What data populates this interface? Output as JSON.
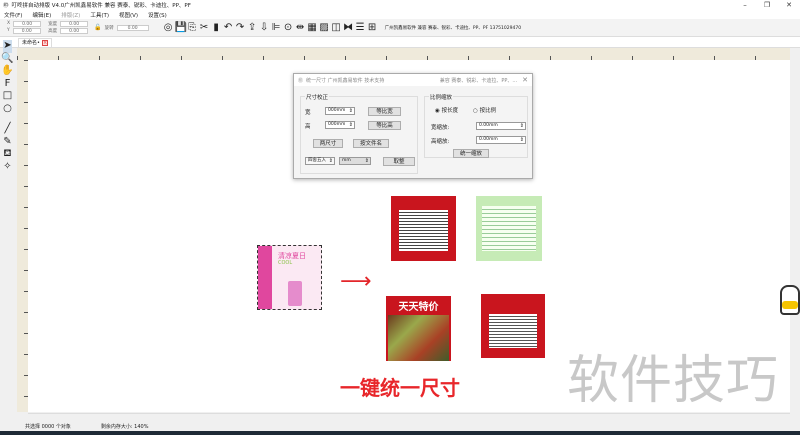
{
  "window": {
    "title": "叮咚拼自动排版 V4.0广州凯鑫易软件 兼容 赛泰、锐彩、卡迪拉、PP、PF"
  },
  "menu": [
    "文件(F)",
    "编辑(E)",
    "排版(Z)",
    "工具(T)",
    "视图(V)",
    "设置(S)"
  ],
  "toolbar": {
    "x_label": "X",
    "y_label": "Y",
    "x": "0.00",
    "y": "0.00",
    "width_label": "宽度",
    "height_label": "高度",
    "width": "0.00",
    "height": "0.00",
    "rotate_label": "旋转",
    "rotate": "0.00",
    "info": "广州凯鑫易软件 兼容 赛泰、锐彩、卡迪拉、PP、PF  13751029470"
  },
  "tab": {
    "label": "未命名•"
  },
  "dialog": {
    "title": "统一尺寸 广州凯鑫易软件 技术支持",
    "title_right": "兼容 赛泰、锐彩、卡迪拉、PP、...",
    "size_group": "尺寸校正",
    "width_label": "宽",
    "height_label": "高",
    "width_value": "000mm",
    "height_value": "000mm",
    "equal_width_btn": "等比宽",
    "equal_height_btn": "等比高",
    "two_size_btn": "两尺寸",
    "by_filename_btn": "按文件名",
    "rounding": "四舍五入",
    "unit": "mm",
    "setup_btn": "取整",
    "scale_group": "比例缩放",
    "by_length": "按长度",
    "by_ratio": "按比例",
    "width_scale_label": "宽缩放:",
    "height_scale_label": "高缩放:",
    "width_scale": "0.00mm",
    "height_scale": "0.00mm",
    "scale_btn": "统一缩放"
  },
  "canvas": {
    "slogan": "一键统一尺寸",
    "card_title": "清凉夏日",
    "card_sub": "COOL",
    "poster_title": "天天特价"
  },
  "status": {
    "selected": "共选择 0000 个对象",
    "memory": "剩余内存大小: 140%"
  },
  "watermark": "软件技巧"
}
